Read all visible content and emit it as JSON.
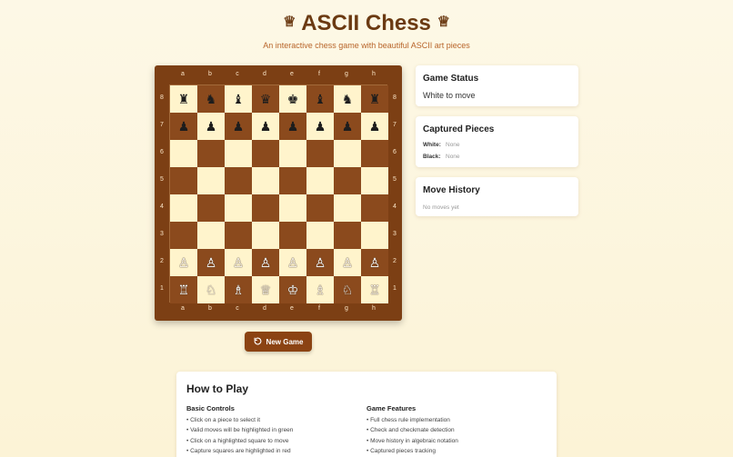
{
  "header": {
    "crown_left": "♕",
    "title": "ASCII Chess",
    "crown_right": "♕",
    "subtitle": "An interactive chess game with beautiful ASCII art pieces"
  },
  "board": {
    "files": [
      "a",
      "b",
      "c",
      "d",
      "e",
      "f",
      "g",
      "h"
    ],
    "ranks": [
      "8",
      "7",
      "6",
      "5",
      "4",
      "3",
      "2",
      "1"
    ],
    "rows": [
      [
        "♜",
        "♞",
        "♝",
        "♛",
        "♚",
        "♝",
        "♞",
        "♜"
      ],
      [
        "♟",
        "♟",
        "♟",
        "♟",
        "♟",
        "♟",
        "♟",
        "♟"
      ],
      [
        "",
        "",
        "",
        "",
        "",
        "",
        "",
        ""
      ],
      [
        "",
        "",
        "",
        "",
        "",
        "",
        "",
        ""
      ],
      [
        "",
        "",
        "",
        "",
        "",
        "",
        "",
        ""
      ],
      [
        "",
        "",
        "",
        "",
        "",
        "",
        "",
        ""
      ],
      [
        "♙",
        "♙",
        "♙",
        "♙",
        "♙",
        "♙",
        "♙",
        "♙"
      ],
      [
        "♖",
        "♘",
        "♗",
        "♕",
        "♔",
        "♗",
        "♘",
        "♖"
      ]
    ],
    "light_color": "#fff4cc",
    "dark_color": "#8b4a1d",
    "frame_color": "#7c3f14"
  },
  "new_game": {
    "icon": "refresh-icon",
    "label": "New Game"
  },
  "status": {
    "title": "Game Status",
    "text": "White to move"
  },
  "captured": {
    "title": "Captured Pieces",
    "white_label": "White:",
    "white_value": "None",
    "black_label": "Black:",
    "black_value": "None"
  },
  "history": {
    "title": "Move History",
    "empty": "No moves yet"
  },
  "how_to_play": {
    "title": "How to Play",
    "controls_title": "Basic Controls",
    "controls": [
      "• Click on a piece to select it",
      "• Valid moves will be highlighted in green",
      "• Click on a highlighted square to move",
      "• Capture squares are highlighted in red"
    ],
    "features_title": "Game Features",
    "features": [
      "• Full chess rule implementation",
      "• Check and checkmate detection",
      "• Move history in algebraic notation",
      "• Captured pieces tracking"
    ]
  }
}
